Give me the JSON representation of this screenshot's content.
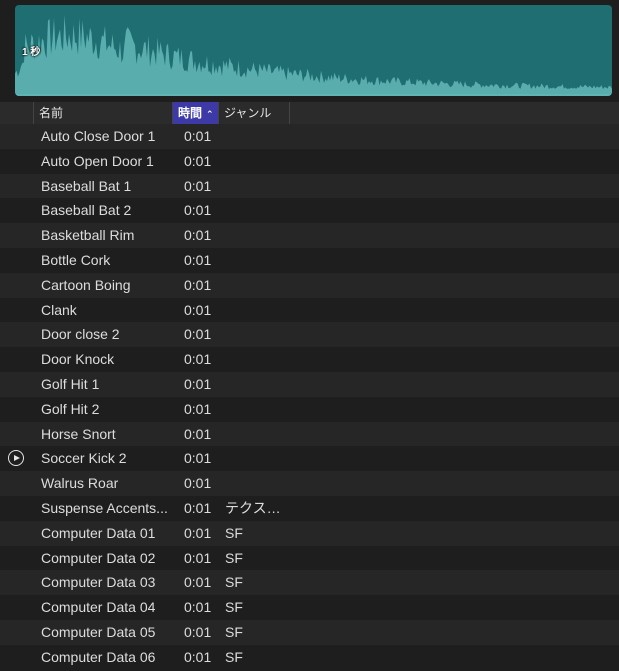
{
  "waveform": {
    "time_label": "1 秒",
    "wave_color": "#5fb4b4",
    "bg_color": "#1f6f72"
  },
  "header": {
    "name": "名前",
    "time": "時間",
    "genre": "ジャンル",
    "sort_indicator_icon": "chevron-up-icon"
  },
  "rows": [
    {
      "name": "Auto Close Door 1",
      "time": "0:01",
      "genre": ""
    },
    {
      "name": "Auto Open Door 1",
      "time": "0:01",
      "genre": ""
    },
    {
      "name": "Baseball Bat 1",
      "time": "0:01",
      "genre": ""
    },
    {
      "name": "Baseball Bat 2",
      "time": "0:01",
      "genre": ""
    },
    {
      "name": "Basketball Rim",
      "time": "0:01",
      "genre": ""
    },
    {
      "name": "Bottle Cork",
      "time": "0:01",
      "genre": ""
    },
    {
      "name": "Cartoon Boing",
      "time": "0:01",
      "genre": ""
    },
    {
      "name": "Clank",
      "time": "0:01",
      "genre": ""
    },
    {
      "name": "Door close 2",
      "time": "0:01",
      "genre": ""
    },
    {
      "name": "Door Knock",
      "time": "0:01",
      "genre": ""
    },
    {
      "name": "Golf Hit 1",
      "time": "0:01",
      "genre": ""
    },
    {
      "name": "Golf Hit 2",
      "time": "0:01",
      "genre": ""
    },
    {
      "name": "Horse Snort",
      "time": "0:01",
      "genre": ""
    },
    {
      "name": "Soccer Kick 2",
      "time": "0:01",
      "genre": "",
      "playing": true
    },
    {
      "name": "Walrus Roar",
      "time": "0:01",
      "genre": ""
    },
    {
      "name": "Suspense Accents...",
      "time": "0:01",
      "genre": "テクス…"
    },
    {
      "name": "Computer Data 01",
      "time": "0:01",
      "genre": "SF"
    },
    {
      "name": "Computer Data 02",
      "time": "0:01",
      "genre": "SF"
    },
    {
      "name": "Computer Data 03",
      "time": "0:01",
      "genre": "SF"
    },
    {
      "name": "Computer Data 04",
      "time": "0:01",
      "genre": "SF"
    },
    {
      "name": "Computer Data 05",
      "time": "0:01",
      "genre": "SF"
    },
    {
      "name": "Computer Data 06",
      "time": "0:01",
      "genre": "SF"
    }
  ]
}
